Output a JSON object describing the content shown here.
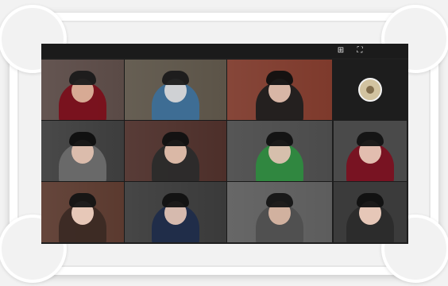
{
  "topbar": {
    "icons": [
      {
        "name": "grid-view-icon",
        "glyph": "⊞"
      },
      {
        "name": "fullscreen-icon",
        "glyph": "⛶"
      }
    ]
  },
  "tiles": [
    {
      "bg": "#5a4a46",
      "shirt": "#7a0f1b",
      "skin": "#dcb39b",
      "hair": "#1a1a1a"
    },
    {
      "bg": "#5c5448",
      "shirt": "#3c6f98",
      "skin": "#d7d7d7",
      "hair": "#1a1a1a"
    },
    {
      "bg": "#7e3a2c",
      "shirt": "#1f1f1f",
      "skin": "#e3bfae",
      "hair": "#101010"
    },
    {
      "bg": "#3d3d3d",
      "shirt": "#6c6c6c",
      "skin": "#e2c1b0",
      "hair": "#0f0f0f"
    },
    {
      "bg": "#4d2f2a",
      "shirt": "#2b2b2b",
      "skin": "#e4c0ad",
      "hair": "#111111"
    },
    {
      "bg": "#4b4b4b",
      "shirt": "#2e8a3f",
      "skin": "#dfc2b2",
      "hair": "#111111"
    },
    {
      "bg": "#5b3a2f",
      "shirt": "#3b2a24",
      "skin": "#f0d1c1",
      "hair": "#141414"
    },
    {
      "bg": "#3a3a3a",
      "shirt": "#1f2c4a",
      "skin": "#e0c2b4",
      "hair": "#111111"
    },
    {
      "bg": "#5d5d5d",
      "shirt": "#4f4f4f",
      "skin": "#d8b6a3",
      "hair": "#151515"
    }
  ],
  "right": {
    "avatar": {
      "bg": "#d2c3a0",
      "fg": "#6f5a3a"
    },
    "tiles": [
      {
        "bg": "#4a4a4a",
        "shirt": "#7a1020",
        "skin": "#e8c6b7",
        "hair": "#121212"
      },
      {
        "bg": "#3b3b3b",
        "shirt": "#2b2b2b",
        "skin": "#f0d0c0",
        "hair": "#101010"
      }
    ]
  }
}
